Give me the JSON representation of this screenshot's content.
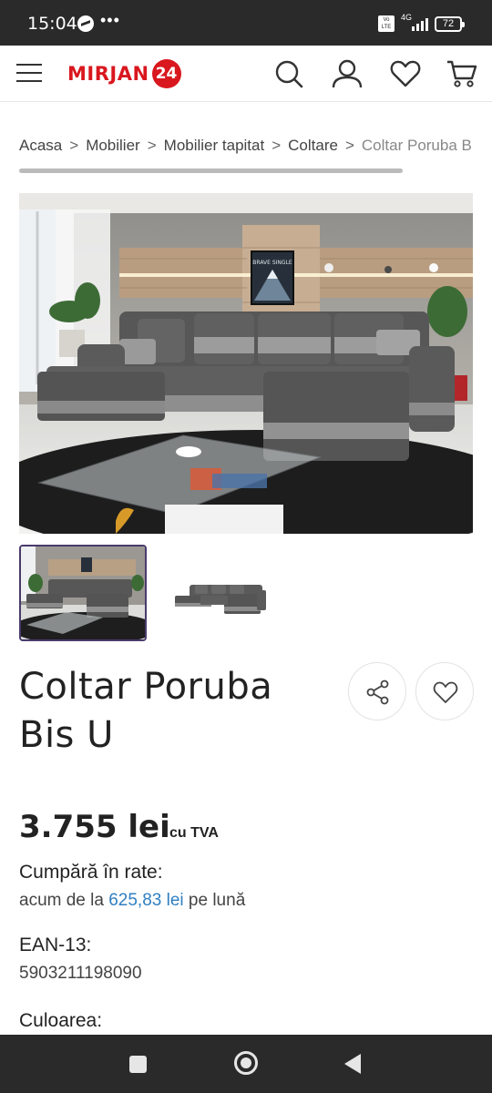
{
  "status_bar": {
    "time": "15:04",
    "network": "4G",
    "volte": "Vo LTE",
    "battery": "72"
  },
  "header": {
    "logo_text": "MIRJAN",
    "logo_badge": "24",
    "brand_color": "#d9171e",
    "icons": [
      "menu-icon",
      "search-icon",
      "user-icon",
      "heart-icon",
      "cart-icon"
    ]
  },
  "breadcrumb": {
    "items": [
      "Acasa",
      "Mobilier",
      "Mobilier tapitat",
      "Coltare",
      "Coltar Poruba Bis U"
    ],
    "separator": ">"
  },
  "gallery": {
    "poster_text": "BRAVE SINGLE",
    "thumbnails": [
      "thumbnail-room",
      "thumbnail-sofa"
    ]
  },
  "product": {
    "title": "Coltar Poruba Bis U",
    "price": "3.755 lei",
    "price_tax": "cu TVA",
    "installments_label": "Cumpără în rate:",
    "installments_prefix": "acum de la",
    "installments_amount": "625,83 lei",
    "installments_suffix": "pe lună",
    "ean_label": "EAN-13:",
    "ean_value": "5903211198090",
    "color_label": "Culoarea:"
  },
  "colors": {
    "link": "#2f7fc1",
    "thumb_border": "#4a3a6b"
  }
}
